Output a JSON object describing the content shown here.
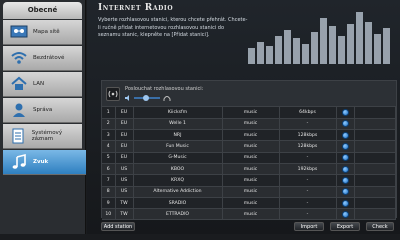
{
  "sidebar": {
    "header": "Obecné",
    "items": [
      {
        "label": "Mapa sítě",
        "icon": "network-map-icon"
      },
      {
        "label": "Bezdrátové",
        "icon": "wifi-icon"
      },
      {
        "label": "LAN",
        "icon": "home-icon"
      },
      {
        "label": "Správa",
        "icon": "person-icon"
      },
      {
        "label": "Systémový záznam",
        "icon": "log-icon"
      },
      {
        "label": "Zvuk",
        "icon": "music-note-icon"
      }
    ],
    "active_index": 5
  },
  "main": {
    "title": "Internet Radio",
    "description": "Vyberte rozhlasovou stanici, kterou chcete přehrát. Chcete-li ručně přidat internetovou rozhlasovou stanici do seznamu stanic, klepněte na [Přidat stanici].",
    "player": {
      "label": "Poslouchat rozhlasovou stanici:",
      "volume": 0.4
    },
    "stations": [
      {
        "n": "1",
        "region": "EU",
        "name": "Kiicksfm",
        "genre": "music",
        "bitrate": "64kbps"
      },
      {
        "n": "2",
        "region": "EU",
        "name": "Welle 1",
        "genre": "music",
        "bitrate": "-"
      },
      {
        "n": "3",
        "region": "EU",
        "name": "NRJ",
        "genre": "music",
        "bitrate": "128kbps"
      },
      {
        "n": "4",
        "region": "EU",
        "name": "Fun Music",
        "genre": "music",
        "bitrate": "128kbps"
      },
      {
        "n": "5",
        "region": "EU",
        "name": "G-Music",
        "genre": "music",
        "bitrate": "-"
      },
      {
        "n": "6",
        "region": "US",
        "name": "KBOO",
        "genre": "music",
        "bitrate": "192kbps"
      },
      {
        "n": "7",
        "region": "US",
        "name": "KRXQ",
        "genre": "music",
        "bitrate": "-"
      },
      {
        "n": "8",
        "region": "US",
        "name": "Alternative Addiction",
        "genre": "music",
        "bitrate": "-"
      },
      {
        "n": "9",
        "region": "TW",
        "name": "SRADIO",
        "genre": "music",
        "bitrate": "-"
      },
      {
        "n": "10",
        "region": "TW",
        "name": "ETTRADIO",
        "genre": "music",
        "bitrate": "-"
      }
    ],
    "buttons": {
      "add": "Add station",
      "import": "Import",
      "export": "Export",
      "check": "Check"
    }
  },
  "colors": {
    "accent": "#2e7fc0",
    "row_button": "#1d6fc4"
  }
}
